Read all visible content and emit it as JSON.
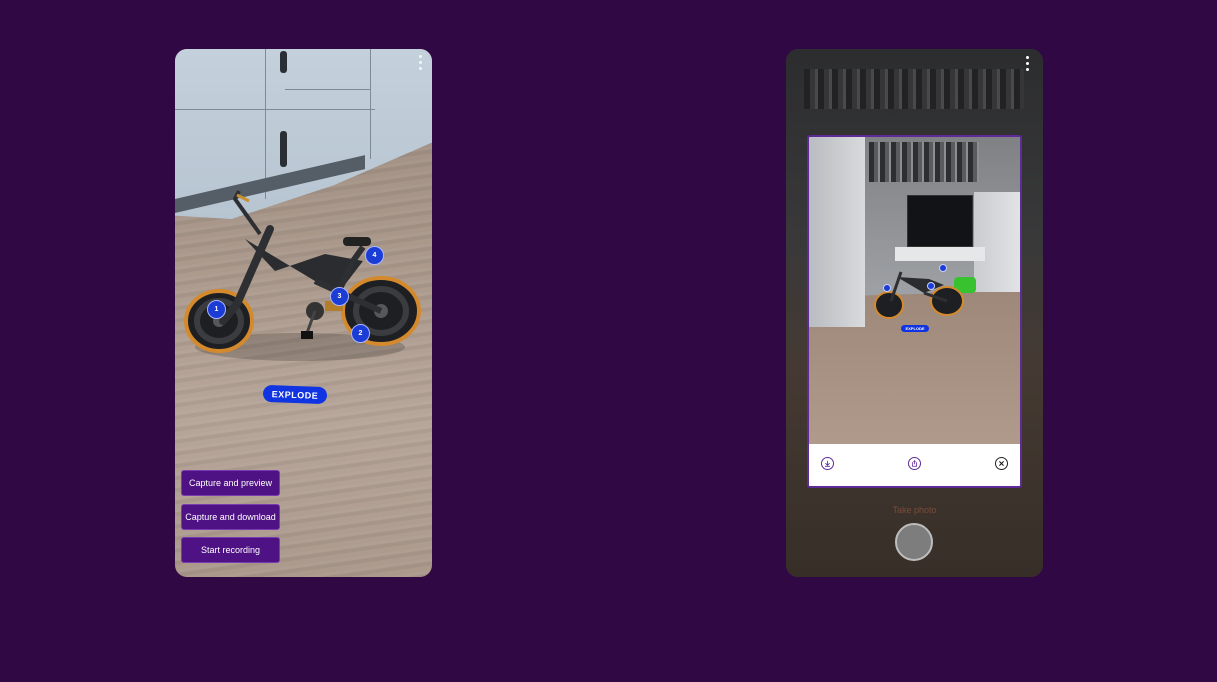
{
  "left_screen": {
    "hotspots": [
      "1",
      "2",
      "3",
      "4"
    ],
    "explode_label": "EXPLODE",
    "buttons": {
      "capture_preview": "Capture and preview",
      "capture_download": "Capture and download",
      "start_recording": "Start recording"
    },
    "menu_icon": "more-vert-icon"
  },
  "right_screen": {
    "menu_icon": "more-vert-icon",
    "preview": {
      "explode_label": "EXPLODE",
      "actions": [
        "download-icon",
        "share-icon",
        "close-icon"
      ]
    },
    "take_photo_label": "Take photo",
    "shutter_icon": "shutter-button"
  },
  "colors": {
    "background": "#300843",
    "button_bg": "#4e1284",
    "hotspot": "#1c3cd6",
    "explode": "#1034e2",
    "preview_border": "#5d2a98"
  }
}
